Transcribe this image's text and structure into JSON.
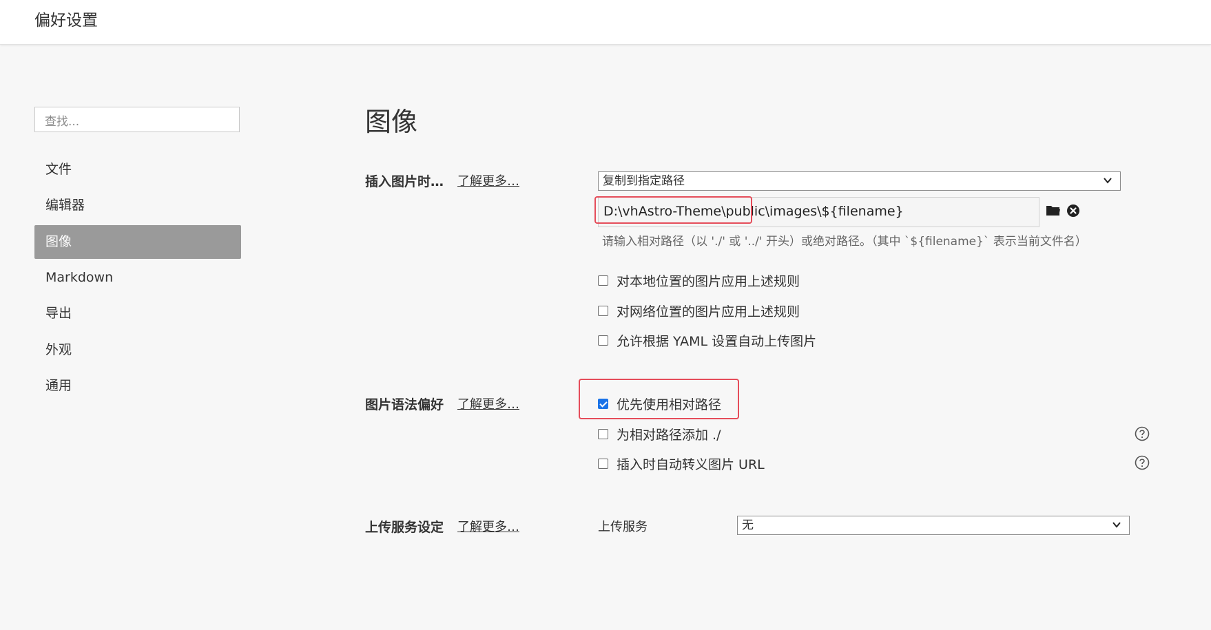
{
  "window": {
    "title": "偏好设置"
  },
  "sidebar": {
    "search_placeholder": "查找...",
    "items": [
      {
        "label": "文件"
      },
      {
        "label": "编辑器"
      },
      {
        "label": "图像"
      },
      {
        "label": "Markdown"
      },
      {
        "label": "导出"
      },
      {
        "label": "外观"
      },
      {
        "label": "通用"
      }
    ],
    "active_index": 2
  },
  "main": {
    "title": "图像",
    "insert": {
      "label": "插入图片时…",
      "learn_more": "了解更多…",
      "action_select": "复制到指定路径",
      "path_value": "D:\\vhAstro-Theme\\public\\images\\${filename}",
      "hint": "请输入相对路径（以 './' 或 '../' 开头）或绝对路径。（其中 `${filename}` 表示当前文件名）",
      "folder_icon": "folder-icon",
      "clear_icon": "clear-circle-icon",
      "options": [
        {
          "label": "对本地位置的图片应用上述规则",
          "checked": false
        },
        {
          "label": "对网络位置的图片应用上述规则",
          "checked": false
        },
        {
          "label": "允许根据 YAML 设置自动上传图片",
          "checked": false
        }
      ]
    },
    "syntax": {
      "label": "图片语法偏好",
      "learn_more": "了解更多…",
      "options": [
        {
          "label": "优先使用相对路径",
          "checked": true
        },
        {
          "label": "为相对路径添加 ./",
          "checked": false,
          "help": true
        },
        {
          "label": "插入时自动转义图片 URL",
          "checked": false,
          "help": true
        }
      ]
    },
    "upload": {
      "label": "上传服务设定",
      "learn_more": "了解更多…",
      "service_label": "上传服务",
      "service_value": "无"
    }
  },
  "colors": {
    "active_nav_bg": "#9a9a9a",
    "highlight_border": "#e54d5a",
    "checkbox_checked": "#1a73e8"
  }
}
